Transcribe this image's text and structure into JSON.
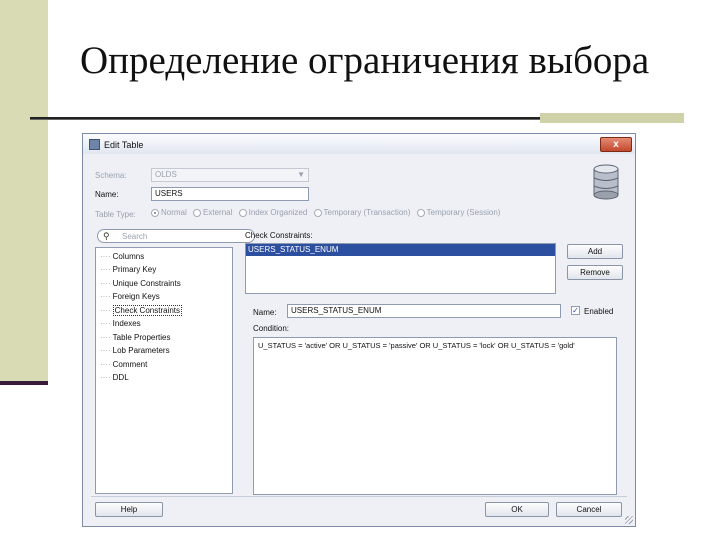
{
  "slide": {
    "title": "Определение ограничения выбора"
  },
  "dialog": {
    "title": "Edit Table",
    "close_glyph": "x",
    "schema": {
      "label": "Schema:",
      "value": "OLDS"
    },
    "name": {
      "label": "Name:",
      "value": "USERS"
    },
    "table_type": {
      "label": "Table Type:",
      "options": [
        {
          "label": "Normal",
          "checked": true
        },
        {
          "label": "External",
          "checked": false
        },
        {
          "label": "Index Organized",
          "checked": false
        },
        {
          "label": "Temporary (Transaction)",
          "checked": false
        },
        {
          "label": "Temporary (Session)",
          "checked": false
        }
      ]
    },
    "search": {
      "placeholder": "Search",
      "icon": "binoculars-icon"
    },
    "tree_items": [
      "Columns",
      "Primary Key",
      "Unique Constraints",
      "Foreign Keys",
      "Check Constraints",
      "Indexes",
      "Table Properties",
      "Lob Parameters",
      "Comment",
      "DDL"
    ],
    "tree_selected": "Check Constraints",
    "check_constraints": {
      "label": "Check Constraints:",
      "items": [
        "USERS_STATUS_ENUM"
      ],
      "selected": "USERS_STATUS_ENUM"
    },
    "buttons": {
      "add": "Add",
      "remove": "Remove",
      "help": "Help",
      "ok": "OK",
      "cancel": "Cancel"
    },
    "constraint_name": {
      "label": "Name:",
      "value": "USERS_STATUS_ENUM"
    },
    "enabled": {
      "label": "Enabled",
      "checked": true
    },
    "condition": {
      "label": "Condition:",
      "value": "U_STATUS = 'active' OR U_STATUS = 'passive' OR U_STATUS = 'lock' OR U_STATUS = 'gold'"
    }
  },
  "colors": {
    "slide_band": "#d9dbb4",
    "selection_blue": "#2d4fa0",
    "dialog_bg": "#eef0f6",
    "close_button": "#c24a2e"
  }
}
